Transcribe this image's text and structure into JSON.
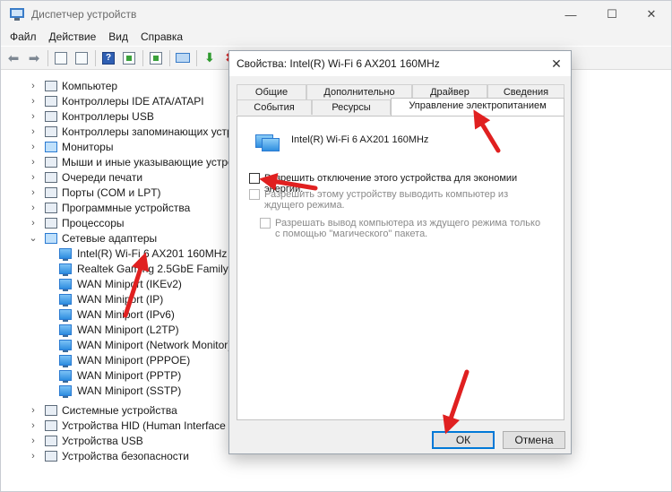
{
  "window": {
    "title": "Диспетчер устройств",
    "controls": [
      "—",
      "☐",
      "✕"
    ]
  },
  "menu": [
    "Файл",
    "Действие",
    "Вид",
    "Справка"
  ],
  "tree": {
    "categories_top": [
      "Компьютер",
      "Контроллеры IDE ATA/ATAPI",
      "Контроллеры USB",
      "Контроллеры запоминающих устро",
      "Мониторы",
      "Мыши и иные указывающие устро",
      "Очереди печати",
      "Порты (COM и LPT)",
      "Программные устройства",
      "Процессоры"
    ],
    "expanded_category": "Сетевые адаптеры",
    "network_devices": [
      "Intel(R) Wi-Fi 6 AX201 160MHz",
      "Realtek Gaming 2.5GbE Family Co",
      "WAN Miniport (IKEv2)",
      "WAN Miniport (IP)",
      "WAN Miniport (IPv6)",
      "WAN Miniport (L2TP)",
      "WAN Miniport (Network Monitor)",
      "WAN Miniport (PPPOE)",
      "WAN Miniport (PPTP)",
      "WAN Miniport (SSTP)"
    ],
    "categories_bottom": [
      "Системные устройства",
      "Устройства HID (Human Interface De",
      "Устройства USB",
      "Устройства безопасности"
    ]
  },
  "dialog": {
    "title": "Свойства: Intel(R) Wi-Fi 6 AX201 160MHz",
    "close": "✕",
    "tabs_row1": [
      "Общие",
      "Дополнительно",
      "Драйвер",
      "Сведения"
    ],
    "tabs_row2": [
      "События",
      "Ресурсы",
      "Управление электропитанием"
    ],
    "device_name": "Intel(R) Wi-Fi 6 AX201 160MHz",
    "option1": "Разрешить отключение этого устройства для экономии энергии.",
    "option2": "Разрешить этому устройству выводить компьютер из ждущего режима.",
    "option3": "Разрешать вывод компьютера из ждущего режима только с помощью \"магического\" пакета.",
    "ok": "ОК",
    "cancel": "Отмена"
  },
  "colors": {
    "annotation_arrow": "#e02020",
    "focus_blue": "#0078d7"
  }
}
